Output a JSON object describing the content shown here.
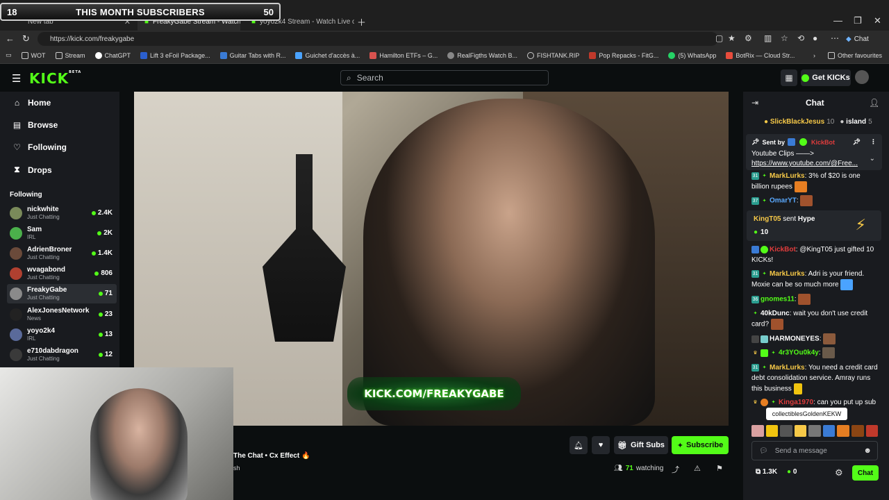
{
  "overlay": {
    "left_count": "18",
    "title": "THIS MONTH SUBSCRIBERS",
    "right_count": "50"
  },
  "browser": {
    "tabs": [
      {
        "label": "New tab"
      },
      {
        "label": "FreakyGabe Stream - Watch Live"
      },
      {
        "label": "yoyo2k4 Stream - Watch Live on K"
      }
    ],
    "url": "https://kick.com/freakygabe",
    "chat_label": "Chat",
    "bookmarks": [
      "WOT",
      "Stream",
      "ChatGPT",
      "Lift 3 eFoil Package...",
      "Guitar Tabs with R...",
      "Guichet d'accès à...",
      "Hamilton ETFs – G...",
      "RealFigths Watch B...",
      "FISHTANK.RIP",
      "Pop Repacks - FitG...",
      "(5) WhatsApp",
      "BotRix — Cloud Str...",
      "Other favourites"
    ]
  },
  "kick": {
    "logo": "KICK",
    "logo_sup": "BETA",
    "search_placeholder": "Search",
    "get_kicks": "Get KICKs"
  },
  "sidebar": {
    "nav": [
      {
        "label": "Home"
      },
      {
        "label": "Browse"
      },
      {
        "label": "Following"
      },
      {
        "label": "Drops"
      }
    ],
    "following_heading": "Following",
    "channels": [
      {
        "name": "nickwhite",
        "category": "Just Chatting",
        "viewers": "2.4K",
        "color": "#7a8a5a"
      },
      {
        "name": "Sam",
        "category": "IRL",
        "viewers": "2K",
        "color": "#4bb04b"
      },
      {
        "name": "AdrienBroner",
        "category": "Just Chatting",
        "viewers": "1.4K",
        "color": "#6a4a3a"
      },
      {
        "name": "wvagabond",
        "category": "Just Chatting",
        "viewers": "806",
        "color": "#b04030"
      },
      {
        "name": "FreakyGabe",
        "category": "Just Chatting",
        "viewers": "71",
        "color": "#8a8a8a"
      },
      {
        "name": "AlexJonesNetwork",
        "category": "News",
        "viewers": "23",
        "color": "#222222"
      },
      {
        "name": "yoyo2k4",
        "category": "IRL",
        "viewers": "13",
        "color": "#5a6a9a"
      },
      {
        "name": "e710dabdragon",
        "category": "Just Chatting",
        "viewers": "12",
        "color": "#3a3a3a"
      }
    ]
  },
  "video": {
    "watermark": "KICK.COM/FREAKYGABE"
  },
  "stream": {
    "title": "The Chat • Cx Effect 🔥",
    "tag": "sh",
    "gift_subs": "Gift Subs",
    "subscribe": "Subscribe",
    "viewers": "71",
    "watching": "watching"
  },
  "chat": {
    "title": "Chat",
    "leaderboard": [
      {
        "name": "SlickBlackJesus",
        "count": "10"
      },
      {
        "name": "island",
        "count": "5"
      }
    ],
    "pinned": {
      "sent_by": "Sent by",
      "sender": "KickBot",
      "line1": "Youtube Clips ——>",
      "line2": "https://www.youtube.com/@Free..."
    },
    "messages": [
      {
        "user": "MarkLurks",
        "text": ": 3% of $20 is one billion rupees",
        "color": "#f7c948"
      },
      {
        "user": "OmarYT",
        "text": ":",
        "color": "#5aa9ff"
      },
      {
        "user": "KickBot",
        "text": ": @KingT05 just gifted 10 KICKs!",
        "color": "#e03c3c"
      },
      {
        "user": "MarkLurks",
        "text": ": Adri is your friend. Moxie can be so much more",
        "color": "#f7c948"
      },
      {
        "user": "gnomes11",
        "text": ":",
        "color": "#53fc18"
      },
      {
        "user": "40kDunc",
        "text": ": wait you don't use credit card?",
        "color": "#ffffff"
      },
      {
        "user": "HARMONEYES",
        "text": ":",
        "color": "#ffffff"
      },
      {
        "user": "4r3YOu0k4y",
        "text": ":",
        "color": "#53fc18"
      },
      {
        "user": "MarkLurks",
        "text": ": You need a credit card debt consolidation service. Amray runs this business",
        "color": "#f7c948"
      },
      {
        "user": "Kinga1970",
        "text": ": can you put up sub",
        "color": "#e03c3c"
      }
    ],
    "hype": {
      "user": "KingT05",
      "sent": " sent ",
      "item": "Hype",
      "amount": "10"
    },
    "tooltip": "collectiblesGoldenKEKW",
    "send_placeholder": "Send a message",
    "followers": "1.3K",
    "kicks": "0",
    "chat_button": "Chat"
  }
}
